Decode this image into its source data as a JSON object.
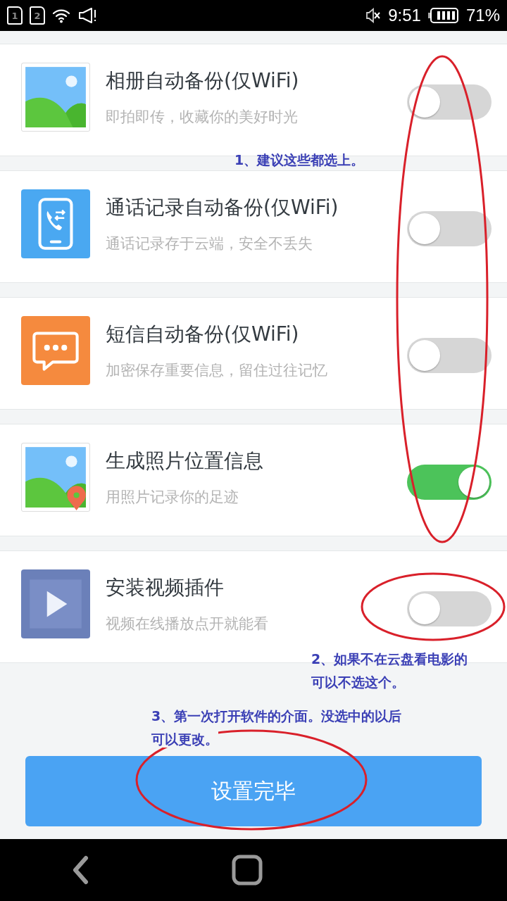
{
  "status_bar": {
    "sims": [
      "1",
      "2"
    ],
    "time": "9:51",
    "battery": "71%"
  },
  "settings": [
    {
      "kind": "photo",
      "title": "相册自动备份(仅WiFi)",
      "subtitle": "即拍即传，收藏你的美好时光",
      "on": false
    },
    {
      "kind": "call",
      "title": "通话记录自动备份(仅WiFi)",
      "subtitle": "通话记录存于云端，安全不丢失",
      "on": false
    },
    {
      "kind": "sms",
      "title": "短信自动备份(仅WiFi)",
      "subtitle": "加密保存重要信息，留住过往记忆",
      "on": false
    },
    {
      "kind": "location",
      "title": "生成照片位置信息",
      "subtitle": "用照片记录你的足迹",
      "on": true
    },
    {
      "kind": "video",
      "title": "安装视频插件",
      "subtitle": "视频在线播放点开就能看",
      "on": false
    }
  ],
  "done_button": "设置完毕",
  "annotations": [
    {
      "lines": [
        "1、建议这些都选上。"
      ]
    },
    {
      "lines": [
        "2、如果不在云盘看电影的",
        "可以不选这个。"
      ]
    },
    {
      "lines": [
        "3、第一次打开软件的介面。没选中的以后",
        "可以更改。"
      ]
    }
  ]
}
